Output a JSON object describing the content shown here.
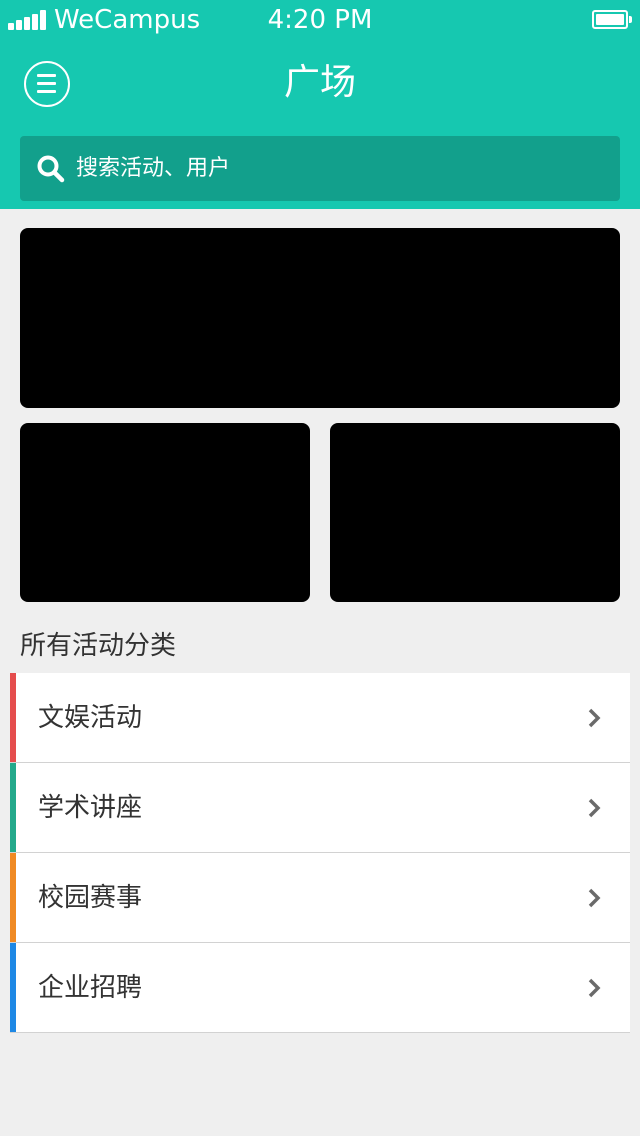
{
  "status_bar": {
    "carrier": "WeCampus",
    "time": "4:20 PM",
    "battery_level": 1.0
  },
  "nav": {
    "title": "广场",
    "menu_icon": "hamburger-menu-icon"
  },
  "search": {
    "placeholder": "搜索活动、用户",
    "icon": "search-icon"
  },
  "section": {
    "title": "所有活动分类"
  },
  "categories": [
    {
      "label": "文娱活动",
      "color": "#e54d4d"
    },
    {
      "label": "学术讲座",
      "color": "#24a98b"
    },
    {
      "label": "校园赛事",
      "color": "#f08a24"
    },
    {
      "label": "企业招聘",
      "color": "#1e88e5"
    }
  ],
  "colors": {
    "brand": "#16c8b0",
    "search_bg": "#12a08c",
    "page_bg": "#efefef"
  }
}
